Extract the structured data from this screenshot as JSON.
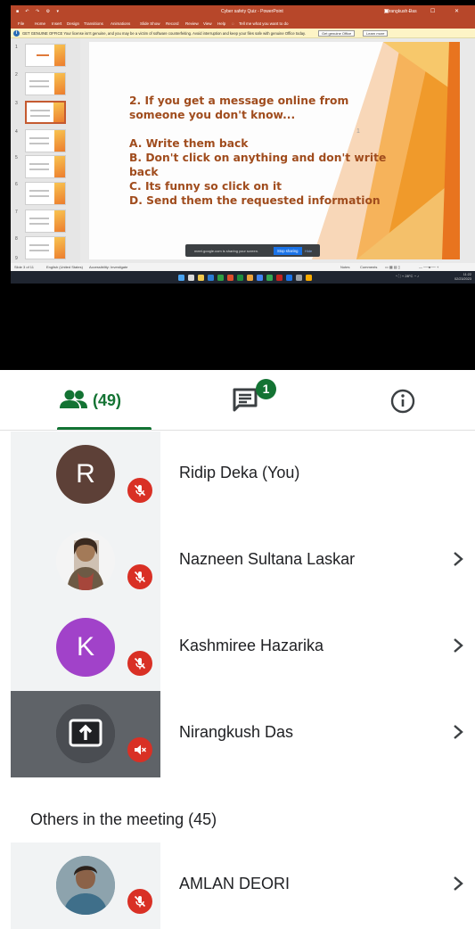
{
  "app": {
    "title_bar": {
      "document": "Cyber safety Quiz - PowerPoint",
      "user": "Nirangkush Das",
      "search": "Tell me what you want to do"
    },
    "ribbon_tabs": [
      "File",
      "Home",
      "Insert",
      "Design",
      "Transitions",
      "Animations",
      "Slide Show",
      "Record",
      "Review",
      "View",
      "Help"
    ],
    "notice": {
      "text": "GET GENUINE OFFICE  Your license isn't genuine, and you may be a victim of software counterfeiting. Avoid interruption and keep your files safe with genuine Office today.",
      "button_primary": "Get genuine Office",
      "button_secondary": "Learn more"
    },
    "thumbnail_numbers": [
      "1",
      "2",
      "3",
      "4",
      "5",
      "6",
      "7",
      "8",
      "9"
    ],
    "slide": {
      "question": "2. If you get a message online from someone you don't know...",
      "options": [
        "A. Write them back",
        "B. Don't click on anything and don't write back",
        "C. Its funny so click on it",
        "D. Send them the requested information"
      ],
      "page_mark": "1"
    },
    "share_bar": {
      "text": "meet.google.com is sharing your screen.",
      "stop": "Stop sharing",
      "hide": "Hide"
    },
    "status_bar": {
      "slide": "Slide 3 of 11",
      "language": "English (United States)",
      "accessibility": "Accessibility: Investigate",
      "notes": "Notes",
      "comments": "Comments"
    },
    "taskbar": {
      "weather": "28°C",
      "time": "11:22",
      "date": "02/23/2023"
    }
  },
  "tabs": {
    "people_count": "(49)",
    "chat_badge": "1"
  },
  "participants": [
    {
      "name": "Ridip Deka (You)",
      "initial": "R",
      "avatar_color": "#5d4037",
      "muted": true
    },
    {
      "name": "Nazneen Sultana Laskar",
      "initial": "",
      "avatar_color": "#cfc1b3",
      "muted": true
    },
    {
      "name": "Kashmiree Hazarika",
      "initial": "K",
      "avatar_color": "#a142c9",
      "muted": true
    },
    {
      "name": "Nirangkush Das",
      "initial": "",
      "avatar_color": "#3c4043",
      "muted": true,
      "presenting": true
    }
  ],
  "others": {
    "title": "Others in the meeting (45)",
    "items": [
      {
        "name": "AMLAN DEORI",
        "avatar_color": "#6b8fa3",
        "muted": true
      }
    ]
  },
  "colors": {
    "accent_green": "#137333",
    "mute_red": "#d93025",
    "slide_text": "#a04c1d",
    "ppt_red": "#b7472a"
  }
}
